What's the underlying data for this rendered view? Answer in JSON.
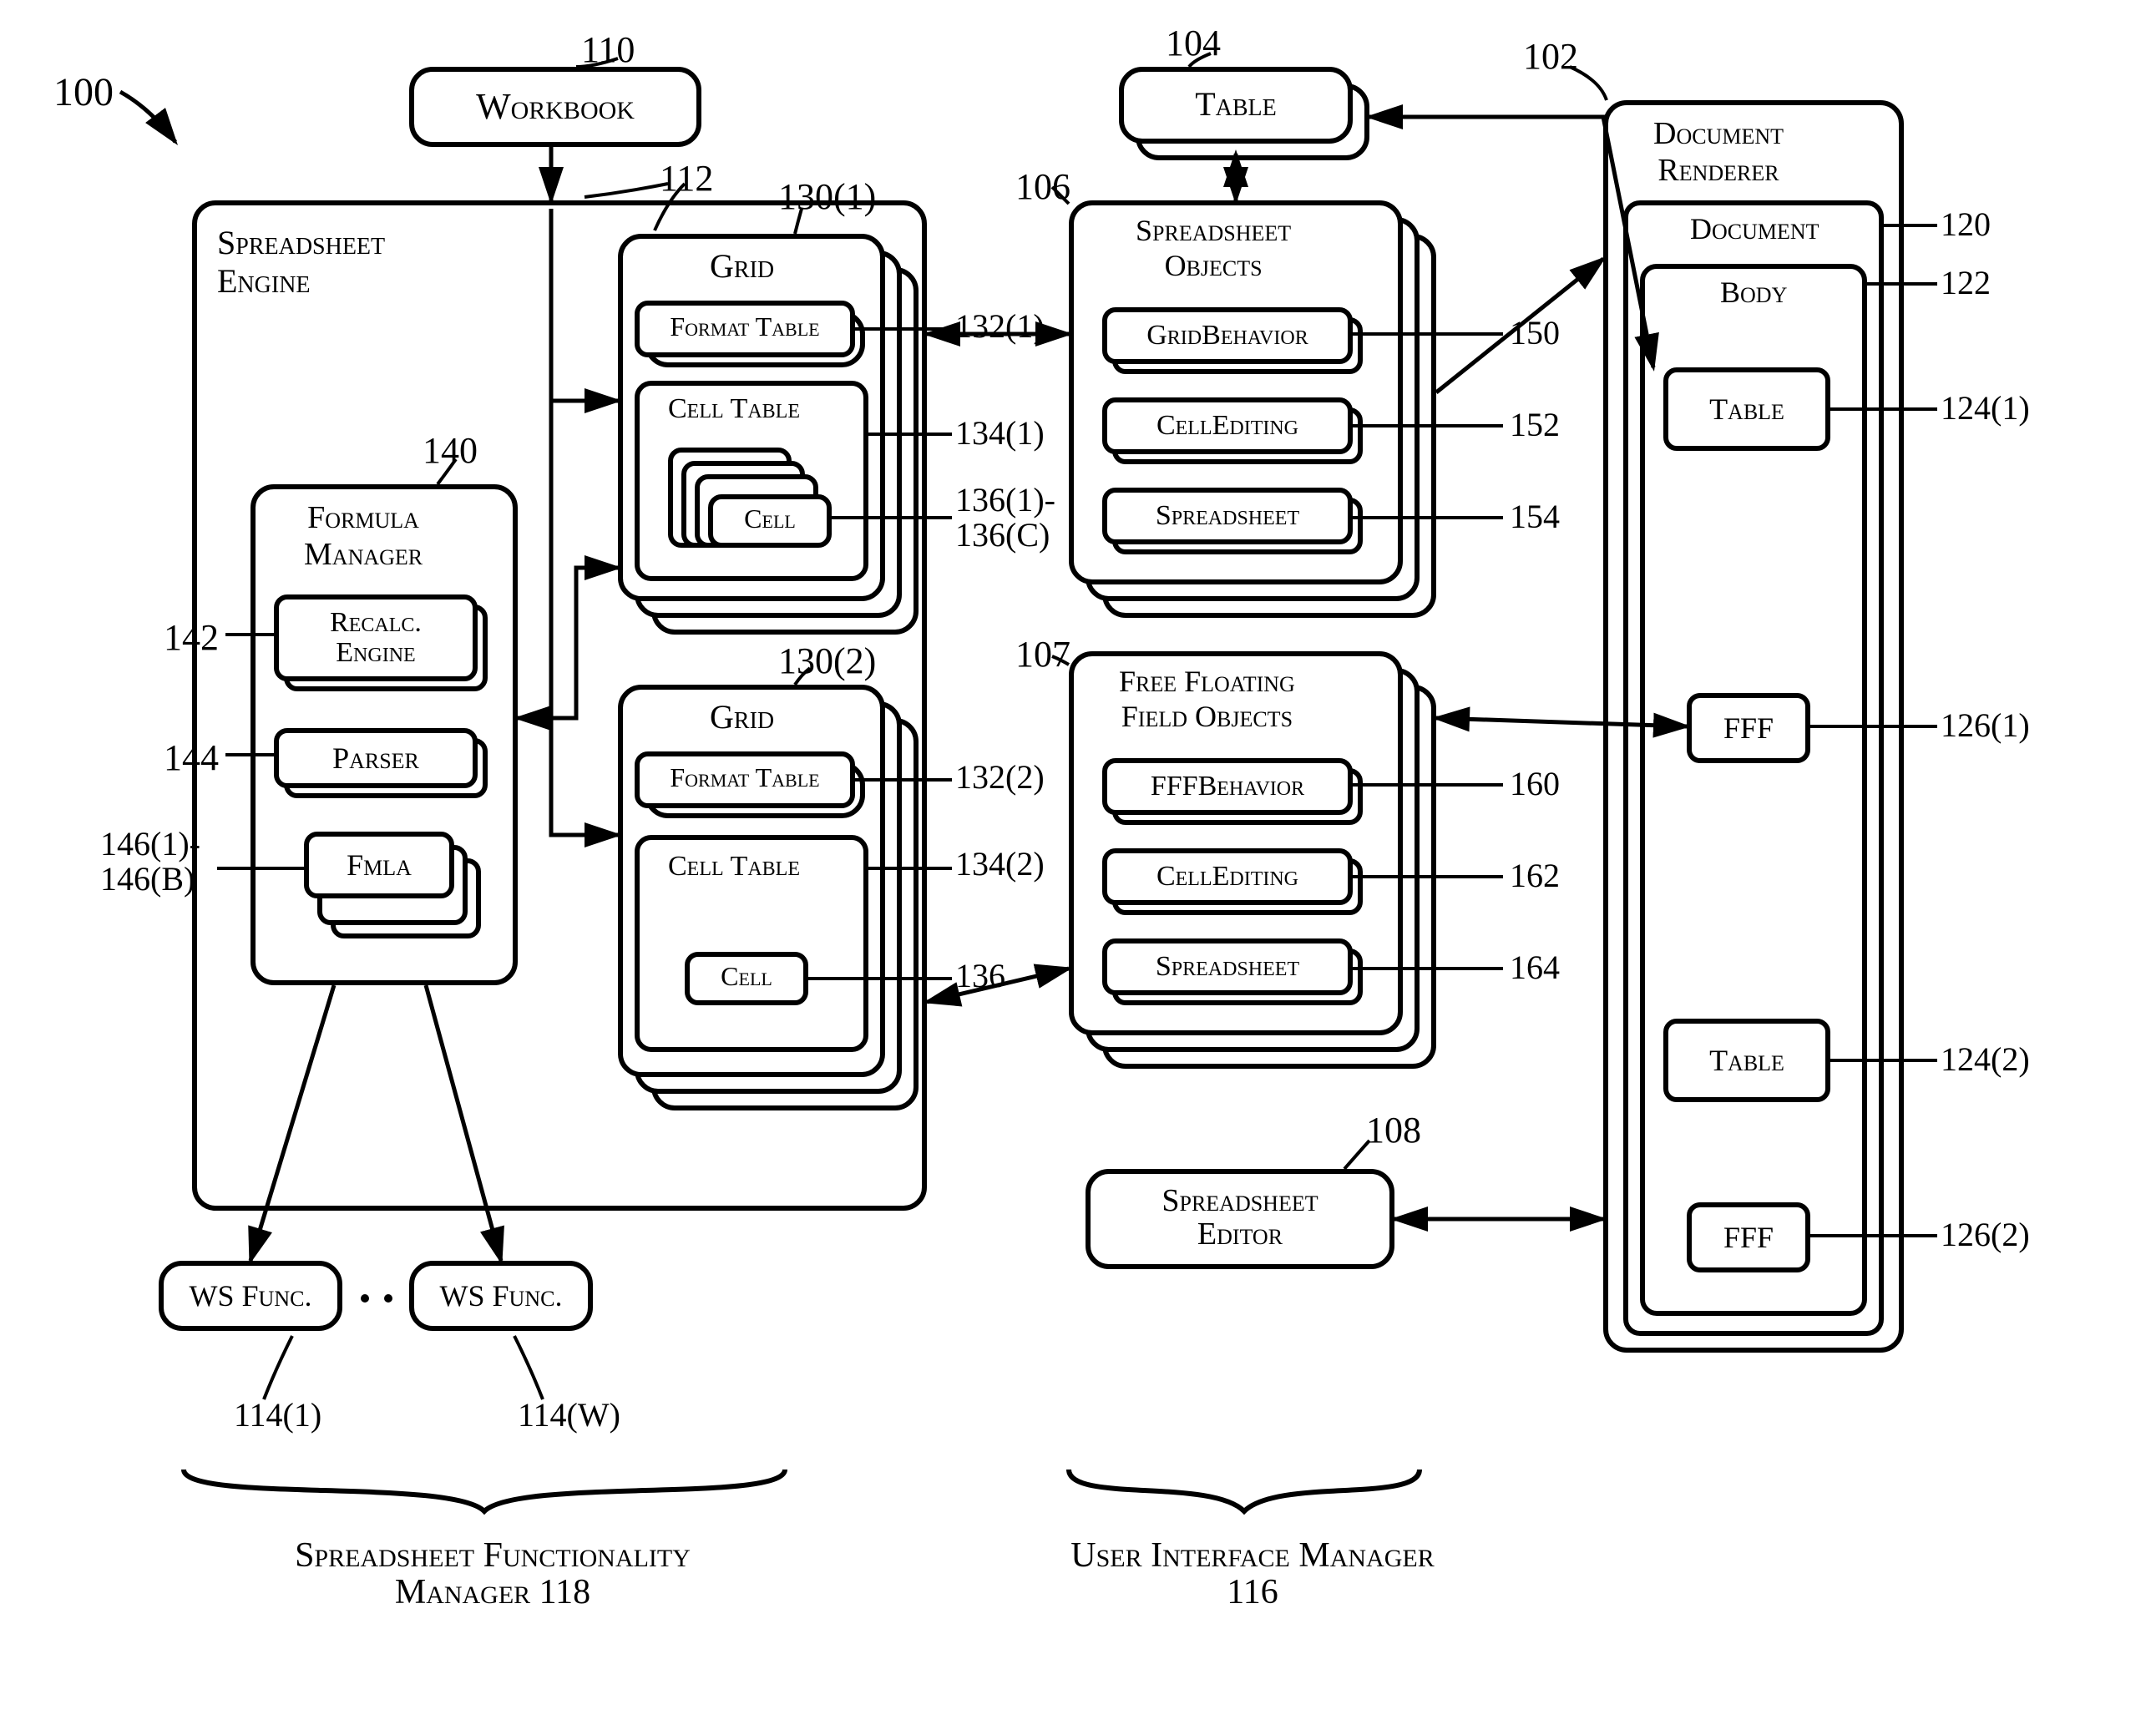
{
  "refs": {
    "r100": "100",
    "r110": "110",
    "r112": "112",
    "r104": "104",
    "r102": "102",
    "r106": "106",
    "r107": "107",
    "r108": "108",
    "r120": "120",
    "r122": "122",
    "r124_1": "124(1)",
    "r124_2": "124(2)",
    "r126_1": "126(1)",
    "r126_2": "126(2)",
    "r130_1": "130(1)",
    "r130_2": "130(2)",
    "r132_1": "132(1)",
    "r132_2": "132(2)",
    "r134_1": "134(1)",
    "r134_2": "134(2)",
    "r136": "136",
    "r136_1c": "136(1)-\n136(C)",
    "r140": "140",
    "r142": "142",
    "r144": "144",
    "r146": "146(1)-\n146(B)",
    "r150": "150",
    "r152": "152",
    "r154": "154",
    "r160": "160",
    "r162": "162",
    "r164": "164",
    "r114_1": "114(1)",
    "r114_w": "114(W)",
    "r118": "Spreadsheet Functionality\nManager 118",
    "r116": "User Interface Manager\n116"
  },
  "blocks": {
    "workbook": "Workbook",
    "spreadsheet_engine": "Spreadsheet\nEngine",
    "grid": "Grid",
    "format_table": "Format Table",
    "cell_table": "Cell Table",
    "cell": "Cell",
    "formula_manager": "Formula\nManager",
    "recalc_engine": "Recalc.\nEngine",
    "parser": "Parser",
    "fmla": "Fmla",
    "ws_func": "WS Func.",
    "table": "Table",
    "document_renderer": "Document\nRenderer",
    "document": "Document",
    "body": "Body",
    "fff": "FFF",
    "spreadsheet_objects": "Spreadsheet\nObjects",
    "gridbehavior": "GridBehavior",
    "cellediting": "CellEditing",
    "spreadsheet": "Spreadsheet",
    "fff_objects": "Free Floating\nField Objects",
    "fffbehavior": "FFFBehavior",
    "spreadsheet_editor": "Spreadsheet\nEditor"
  }
}
